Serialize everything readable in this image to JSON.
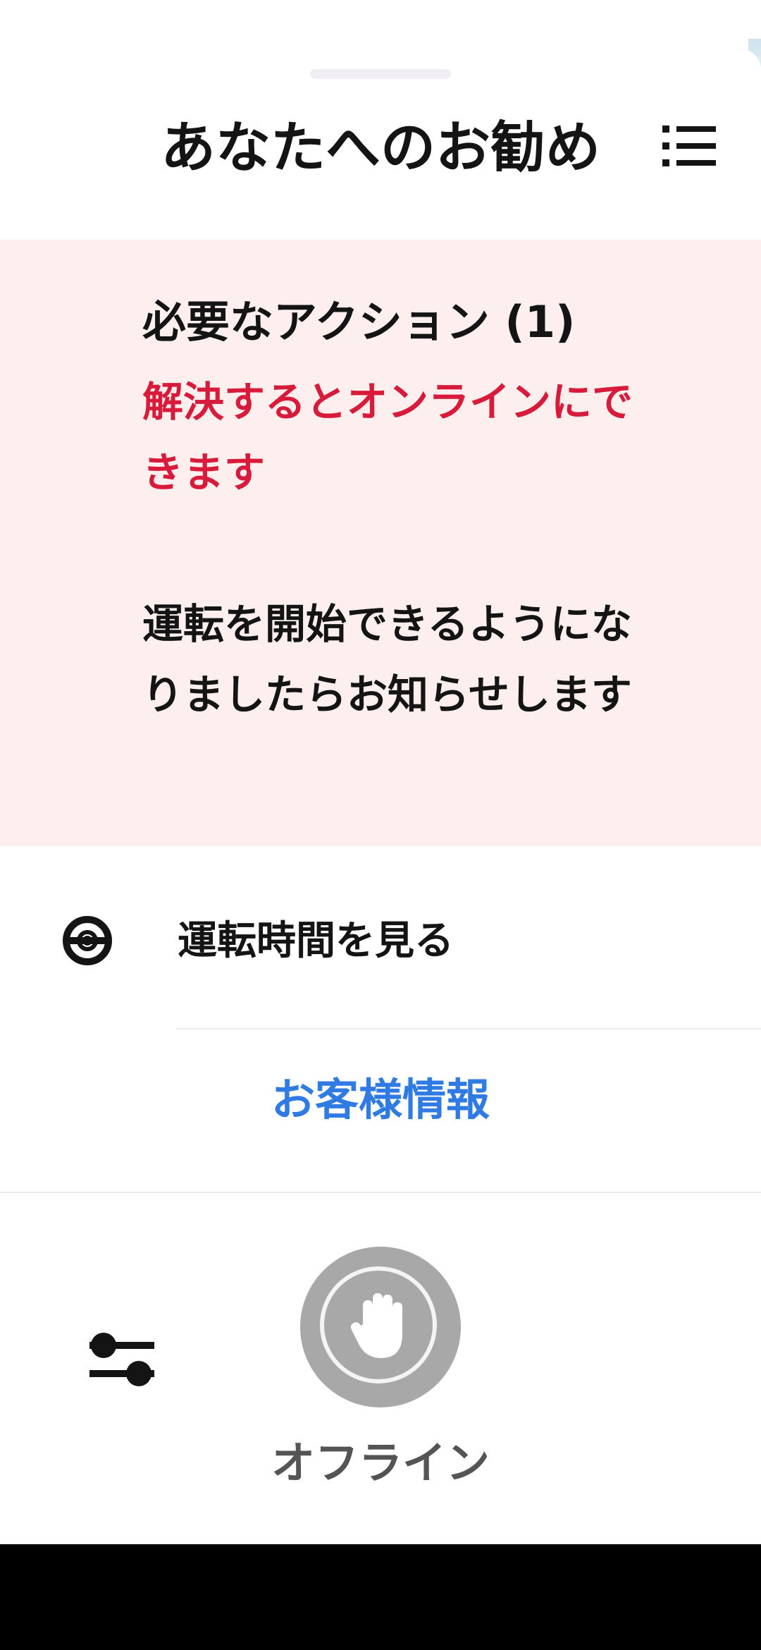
{
  "header": {
    "title": "あなたへのお勧め",
    "menu_icon": "list-icon"
  },
  "alert": {
    "title": "必要なアクション (1)",
    "subtitle": "解決するとオンラインにできます",
    "body": "運転を開始できるようになりましたらお知らせします",
    "title_color": "#141414",
    "subtitle_color": "#d81b3a",
    "background_color": "#fcefee"
  },
  "driving_hours": {
    "label": "運転時間を見る",
    "icon": "steering-wheel-icon"
  },
  "customer_info": {
    "label": "お客様情報",
    "color": "#2f7be3"
  },
  "footer": {
    "settings_icon": "sliders-icon",
    "status_icon": "hand-stop-icon",
    "status_label": "オフライン",
    "status_color": "#a8a8a8"
  }
}
